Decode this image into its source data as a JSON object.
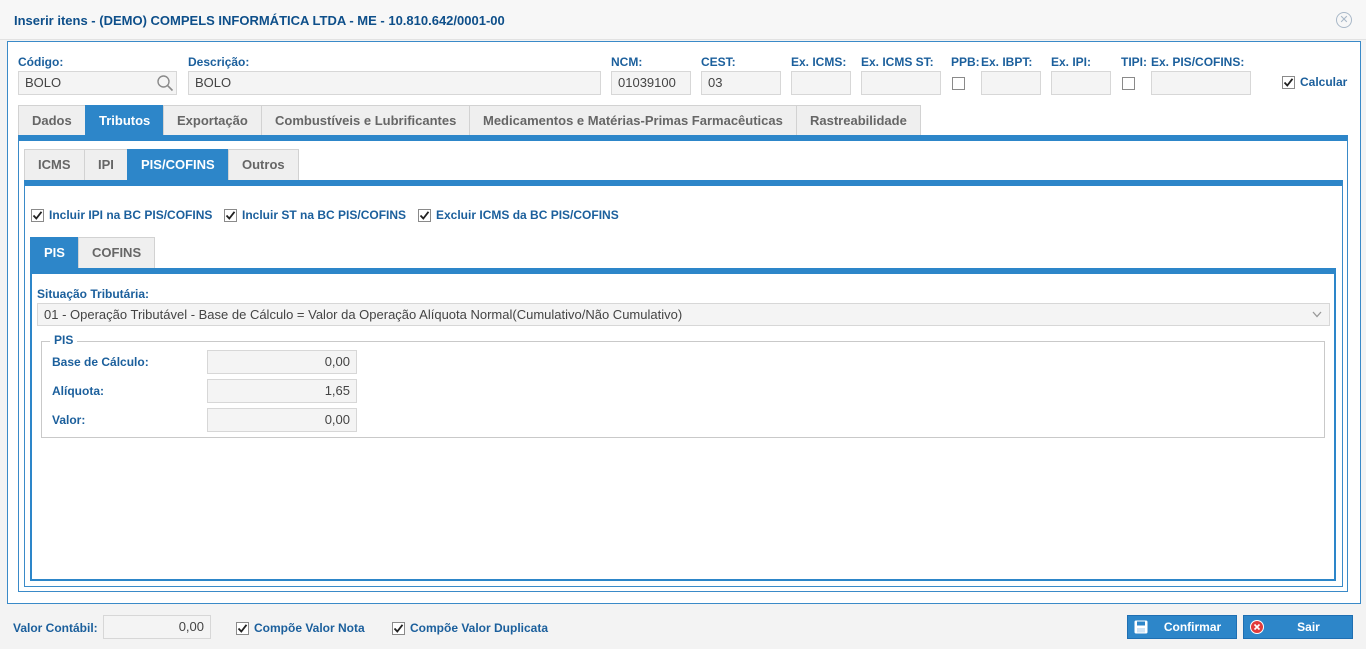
{
  "window": {
    "title": "Inserir itens - (DEMO) COMPELS INFORMÁTICA LTDA - ME - 10.810.642/0001-00",
    "close_icon": "close-circle-icon"
  },
  "header_fields": {
    "codigo": {
      "label": "Código:",
      "value": "BOLO"
    },
    "descricao": {
      "label": "Descrição:",
      "value": "BOLO"
    },
    "ncm": {
      "label": "NCM:",
      "value": "01039100"
    },
    "cest": {
      "label": "CEST:",
      "value": "03"
    },
    "ex_icms": {
      "label": "Ex. ICMS:",
      "value": ""
    },
    "ex_icms_st": {
      "label": "Ex. ICMS ST:",
      "value": ""
    },
    "ppb": {
      "label": "PPB:",
      "checked": false
    },
    "ex_ibpt": {
      "label": "Ex. IBPT:",
      "value": ""
    },
    "ex_ipi": {
      "label": "Ex. IPI:",
      "value": ""
    },
    "tipi": {
      "label": "TIPI:",
      "checked": false
    },
    "ex_pis_cofins": {
      "label": "Ex. PIS/COFINS:",
      "value": ""
    },
    "calcular": {
      "label": "Calcular",
      "checked": true
    }
  },
  "main_tabs": [
    {
      "label": "Dados",
      "active": false
    },
    {
      "label": "Tributos",
      "active": true
    },
    {
      "label": "Exportação",
      "active": false
    },
    {
      "label": "Combustíveis e Lubrificantes",
      "active": false
    },
    {
      "label": "Medicamentos e Matérias-Primas Farmacêuticas",
      "active": false
    },
    {
      "label": "Rastreabilidade",
      "active": false
    }
  ],
  "tax_tabs": [
    {
      "label": "ICMS",
      "active": false
    },
    {
      "label": "IPI",
      "active": false
    },
    {
      "label": "PIS/COFINS",
      "active": true
    },
    {
      "label": "Outros",
      "active": false
    }
  ],
  "options": {
    "incluir_ipi": {
      "label": "Incluir IPI na BC PIS/COFINS",
      "checked": true
    },
    "incluir_st": {
      "label": "Incluir ST na BC PIS/COFINS",
      "checked": true
    },
    "excluir_icms": {
      "label": "Excluir ICMS da BC PIS/COFINS",
      "checked": true
    }
  },
  "pis_tabs": [
    {
      "label": "PIS",
      "active": true
    },
    {
      "label": "COFINS",
      "active": false
    }
  ],
  "pis": {
    "situacao_label": "Situação Tributária:",
    "situacao_value": "01 - Operação Tributável - Base de Cálculo = Valor da Operação Alíquota Normal(Cumulativo/Não Cumulativo)",
    "group_title": "PIS",
    "base_calculo": {
      "label": "Base de Cálculo:",
      "value": "0,00"
    },
    "aliquota": {
      "label": "Alíquota:",
      "value": "1,65"
    },
    "valor": {
      "label": "Valor:",
      "value": "0,00"
    }
  },
  "footer": {
    "valor_contabil": {
      "label": "Valor Contábil:",
      "value": "0,00"
    },
    "compoe_nota": {
      "label": "Compõe Valor Nota",
      "checked": true
    },
    "compoe_duplicata": {
      "label": "Compõe Valor Duplicata",
      "checked": true
    },
    "confirmar_label": "Confirmar",
    "sair_label": "Sair"
  },
  "colors": {
    "accent": "#2d86c9",
    "label": "#1b5f9c",
    "title": "#0e4f8a"
  }
}
